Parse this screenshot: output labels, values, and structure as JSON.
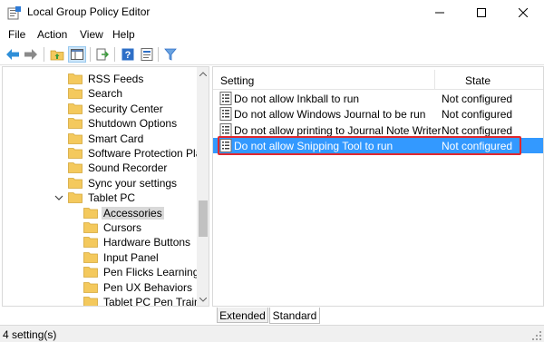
{
  "window": {
    "title": "Local Group Policy Editor",
    "icon": "group-policy-app-icon",
    "controls": [
      "minimize-icon",
      "maximize-icon",
      "close-icon"
    ]
  },
  "menu": [
    "File",
    "Action",
    "View",
    "Help"
  ],
  "toolbar": {
    "buttons": [
      "back-arrow-icon",
      "forward-arrow-icon",
      "up-folder-icon",
      "show-hide-tree-icon",
      "export-list-icon",
      "help-icon",
      "properties-icon",
      "filter-icon"
    ]
  },
  "tree": {
    "items": [
      {
        "label": "RSS Feeds",
        "level": 1
      },
      {
        "label": "Search",
        "level": 1
      },
      {
        "label": "Security Center",
        "level": 1
      },
      {
        "label": "Shutdown Options",
        "level": 1
      },
      {
        "label": "Smart Card",
        "level": 1
      },
      {
        "label": "Software Protection Platfo",
        "level": 1
      },
      {
        "label": "Sound Recorder",
        "level": 1
      },
      {
        "label": "Sync your settings",
        "level": 1
      },
      {
        "label": "Tablet PC",
        "level": 1,
        "expanded": true
      },
      {
        "label": "Accessories",
        "level": 2,
        "selected": true
      },
      {
        "label": "Cursors",
        "level": 2
      },
      {
        "label": "Hardware Buttons",
        "level": 2
      },
      {
        "label": "Input Panel",
        "level": 2
      },
      {
        "label": "Pen Flicks Learning",
        "level": 2
      },
      {
        "label": "Pen UX Behaviors",
        "level": 2
      },
      {
        "label": "Tablet PC Pen Training",
        "level": 2
      }
    ]
  },
  "list": {
    "columns": {
      "setting": "Setting",
      "state": "State"
    },
    "rows": [
      {
        "setting": "Do not allow Inkball to run",
        "state": "Not configured"
      },
      {
        "setting": "Do not allow Windows Journal to be run",
        "state": "Not configured"
      },
      {
        "setting": "Do not allow printing to Journal Note Writer",
        "state": "Not configured"
      },
      {
        "setting": "Do not allow Snipping Tool to run",
        "state": "Not configured",
        "selected": true
      }
    ]
  },
  "tabs": [
    "Extended",
    "Standard"
  ],
  "active_tab": "Standard",
  "status": "4 setting(s)",
  "colors": {
    "selection": "#3399ff",
    "highlight_border": "#e0282e",
    "folder": "#f4c95d",
    "tree_selected": "#d9d9d9"
  }
}
